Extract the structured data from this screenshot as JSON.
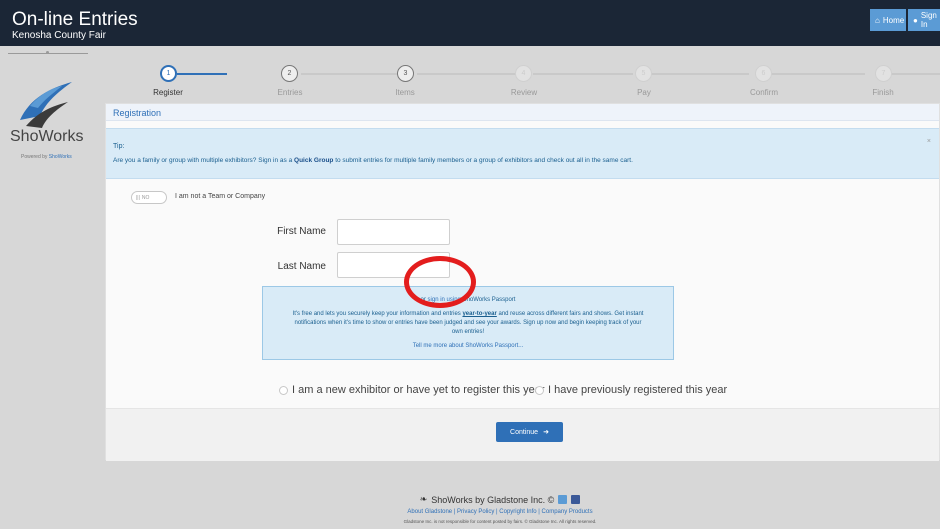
{
  "header": {
    "title": "On-line Entries",
    "subtitle": "Kenosha County Fair",
    "nav": [
      {
        "label": "Home",
        "icon": "home-icon"
      },
      {
        "label": "Sign In",
        "icon": "user-icon"
      }
    ]
  },
  "sidebar": {
    "brand": "ShoWorks",
    "powered_prefix": "Powered by",
    "powered_link": "ShoWorks"
  },
  "steps": [
    {
      "num": "1",
      "label": "Register",
      "state": "current"
    },
    {
      "num": "2",
      "label": "Entries",
      "state": "done"
    },
    {
      "num": "3",
      "label": "Items",
      "state": "done"
    },
    {
      "num": "4",
      "label": "Review",
      "state": "pending"
    },
    {
      "num": "5",
      "label": "Pay",
      "state": "pending"
    },
    {
      "num": "6",
      "label": "Confirm",
      "state": "pending"
    },
    {
      "num": "7",
      "label": "Finish",
      "state": "pending"
    }
  ],
  "registration": {
    "title": "Registration",
    "tip": {
      "title": "Tip:",
      "text_before": "Are you a family or group with multiple exhibitors? Sign in as a",
      "bold": "Quick Group",
      "text_after": "to submit entries for multiple family members or a group of exhibitors and check out all in the same cart.",
      "close": "×"
    },
    "toggle": {
      "state": "NO",
      "label": "I am not a Team or Company"
    },
    "fields": [
      {
        "label": "First Name",
        "value": ""
      },
      {
        "label": "Last Name",
        "value": ""
      }
    ],
    "passport": {
      "line1_prefix": "or",
      "line1_link": "sign in using",
      "line1_suffix": "ShoWorks Passport",
      "line2_prefix": "It's free and lets you securely keep your information and entries",
      "line2_bold": "year-to-year",
      "line2_suffix": "and reuse across different fairs and shows. Get instant",
      "line3": "notifications when it's time to show or entries have been judged and see your awards. Sign up now and begin keeping track of your",
      "line4": "own entries!",
      "more_link": "Tell me more about ShoWorks Passport..."
    },
    "radios": [
      {
        "label": "I am a new exhibitor or have yet to register this year",
        "selected": false
      },
      {
        "label": "I have previously registered this year",
        "selected": false
      }
    ],
    "continue_label": "Continue"
  },
  "footer": {
    "company": "ShoWorks by Gladstone Inc. ©",
    "links": [
      "About Gladstone",
      "Privacy Policy",
      "Copyright Info",
      "Company Products"
    ],
    "disclaimer": "Gladstone Inc. is not responsible for content posted by fairs. © Gladstone Inc. All rights reserved."
  },
  "colors": {
    "header_bg": "#1b2636",
    "accent": "#2f70b7",
    "tip_bg": "#d9ebf7",
    "annotation": "#e31d1d"
  }
}
